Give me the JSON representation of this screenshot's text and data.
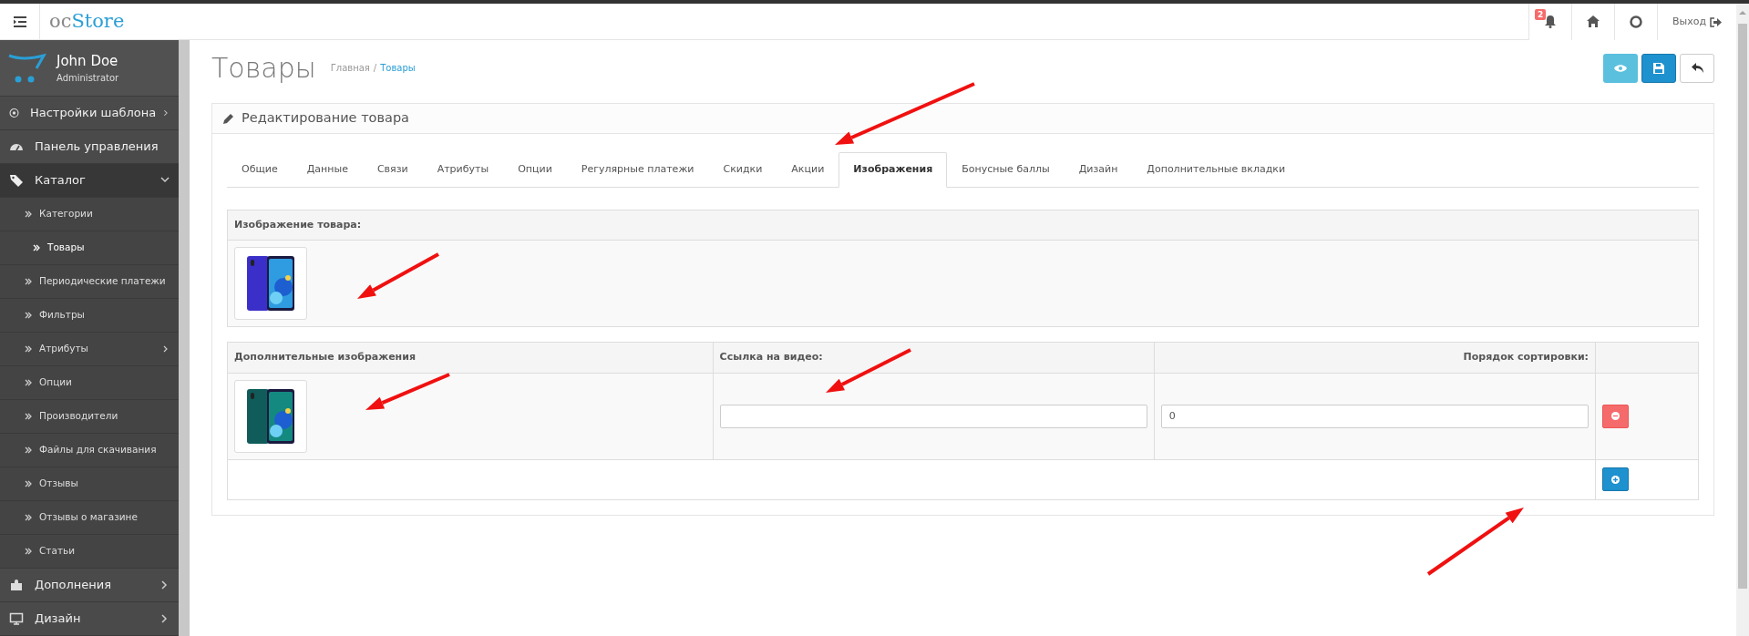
{
  "topbar": {
    "logo_prefix": "oc",
    "logo_suffix": "Store",
    "notifications_count": "2",
    "logout": "Выход"
  },
  "user": {
    "name": "John Doe",
    "role": "Administrator"
  },
  "sidebar": {
    "items": [
      {
        "label": "Настройки шаблона",
        "submenu": true,
        "expanded": false
      },
      {
        "label": "Панель управления",
        "submenu": false,
        "expanded": false
      },
      {
        "label": "Каталог",
        "submenu": true,
        "expanded": true,
        "children": [
          {
            "label": "Категории",
            "selected": false,
            "submenu": false
          },
          {
            "label": "Товары",
            "selected": true,
            "submenu": false
          },
          {
            "label": "Периодические платежи",
            "selected": false,
            "submenu": false
          },
          {
            "label": "Фильтры",
            "selected": false,
            "submenu": false
          },
          {
            "label": "Атрибуты",
            "selected": false,
            "submenu": true
          },
          {
            "label": "Опции",
            "selected": false,
            "submenu": false
          },
          {
            "label": "Производители",
            "selected": false,
            "submenu": false
          },
          {
            "label": "Файлы для скачивания",
            "selected": false,
            "submenu": false
          },
          {
            "label": "Отзывы",
            "selected": false,
            "submenu": false
          },
          {
            "label": "Отзывы о магазине",
            "selected": false,
            "submenu": false
          },
          {
            "label": "Статьи",
            "selected": false,
            "submenu": false
          }
        ]
      },
      {
        "label": "Дополнения",
        "submenu": true,
        "expanded": false
      },
      {
        "label": "Дизайн",
        "submenu": true,
        "expanded": false
      }
    ]
  },
  "page": {
    "title": "Товары",
    "breadcrumbs": [
      {
        "label": "Главная",
        "current": false
      },
      {
        "label": "Товары",
        "current": true
      }
    ],
    "breadcrumb_separator": "/",
    "actions": [
      {
        "kind": "preview"
      },
      {
        "kind": "save"
      },
      {
        "kind": "back"
      }
    ]
  },
  "panel": {
    "title": "Редактирование товара",
    "tabs": [
      {
        "label": "Общие",
        "selected": false
      },
      {
        "label": "Данные",
        "selected": false
      },
      {
        "label": "Связи",
        "selected": false
      },
      {
        "label": "Атрибуты",
        "selected": false
      },
      {
        "label": "Опции",
        "selected": false
      },
      {
        "label": "Регулярные платежи",
        "selected": false
      },
      {
        "label": "Скидки",
        "selected": false
      },
      {
        "label": "Акции",
        "selected": false
      },
      {
        "label": "Изображения",
        "selected": true
      },
      {
        "label": "Бонусные баллы",
        "selected": false
      },
      {
        "label": "Дизайн",
        "selected": false
      },
      {
        "label": "Дополнительные вкладки",
        "selected": false
      }
    ],
    "main_image": {
      "heading": "Изображение товара:"
    },
    "additional_images": {
      "columns": [
        "Дополнительные изображения",
        "Ссылка на видео:",
        "Порядок сортировки:"
      ],
      "rows": [
        {
          "sort_order": "0"
        }
      ]
    }
  }
}
